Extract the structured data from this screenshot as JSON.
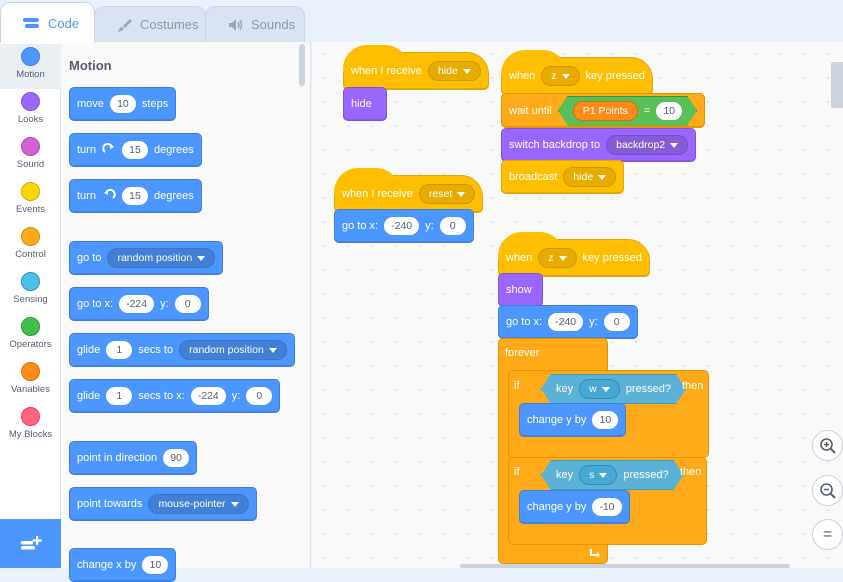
{
  "tabs": [
    {
      "label": "Code",
      "icon": "code-icon",
      "active": true
    },
    {
      "label": "Costumes",
      "icon": "brush-icon",
      "active": false
    },
    {
      "label": "Sounds",
      "icon": "speaker-icon",
      "active": false
    }
  ],
  "categories": [
    {
      "label": "Motion",
      "color": "#4c97ff"
    },
    {
      "label": "Looks",
      "color": "#9966ff"
    },
    {
      "label": "Sound",
      "color": "#cf63cf"
    },
    {
      "label": "Events",
      "color": "#ffbf00"
    },
    {
      "label": "Control",
      "color": "#ffab19"
    },
    {
      "label": "Sensing",
      "color": "#5cb1d6"
    },
    {
      "label": "Operators",
      "color": "#59c059"
    },
    {
      "label": "Variables",
      "color": "#ff8c1a"
    },
    {
      "label": "My Blocks",
      "color": "#ff6680"
    }
  ],
  "palette": {
    "title": "Motion",
    "move": {
      "word": "move",
      "value": "10",
      "suffix": "steps"
    },
    "turn_right": {
      "word": "turn",
      "value": "15",
      "suffix": "degrees"
    },
    "turn_left": {
      "word": "turn",
      "value": "15",
      "suffix": "degrees"
    },
    "goto": {
      "word": "go to",
      "option": "random position"
    },
    "goto_xy": {
      "word": "go to x:",
      "x": "-224",
      "ylabel": "y:",
      "y": "0"
    },
    "glide": {
      "word": "glide",
      "secs": "1",
      "mid": "secs to",
      "option": "random position"
    },
    "glide_xy": {
      "word": "glide",
      "secs": "1",
      "mid": "secs to x:",
      "x": "-224",
      "ylabel": "y:",
      "y": "0"
    },
    "point_dir": {
      "word": "point in direction",
      "value": "90"
    },
    "point_towards": {
      "word": "point towards",
      "option": "mouse-pointer"
    },
    "change_x": {
      "word": "change x by",
      "value": "10"
    }
  },
  "scripts": {
    "s1": {
      "hat": "when I receive",
      "msg": "hide",
      "action": "hide"
    },
    "s2": {
      "hat": "when I receive",
      "msg": "reset",
      "goto": "go to x:",
      "x": "-240",
      "ylabel": "y:",
      "y": "0"
    },
    "s3": {
      "when": "when",
      "key": "z",
      "pressed": "key pressed",
      "wait": "wait until",
      "var": "P1 Points",
      "eq": "=",
      "num": "10",
      "switch": "switch backdrop to",
      "backdrop": "backdrop2",
      "broadcast": "broadcast",
      "bmsg": "hide"
    },
    "s4": {
      "when": "when",
      "key": "z",
      "pressed": "key pressed",
      "show": "show",
      "goto": "go to x:",
      "x": "-240",
      "ylabel": "y:",
      "y": "0",
      "forever": "forever",
      "if1": {
        "if": "if",
        "key_word": "key",
        "key": "w",
        "pressed": "pressed?",
        "then": "then",
        "change": "change y by",
        "value": "10"
      },
      "if2": {
        "if": "if",
        "key_word": "key",
        "key": "s",
        "pressed": "pressed?",
        "then": "then",
        "change": "change y by",
        "value": "-10"
      }
    }
  },
  "zoom": {
    "in": "zoom-in-icon",
    "out": "zoom-out-icon",
    "reset": "zoom-reset-icon",
    "reset_glyph": "="
  }
}
